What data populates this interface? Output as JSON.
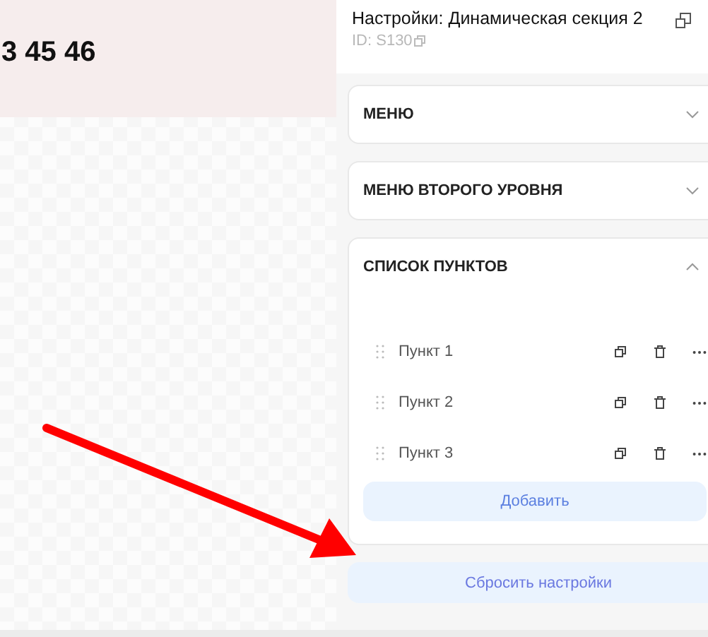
{
  "canvas": {
    "heading": "3 45 46"
  },
  "panel": {
    "title": "Настройки: Динамическая секция 2",
    "id_label": "ID: S130",
    "sections": [
      {
        "title": "МЕНЮ",
        "expanded": false
      },
      {
        "title": "МЕНЮ ВТОРОГО УРОВНЯ",
        "expanded": false
      },
      {
        "title": "СПИСОК ПУНКТОВ",
        "expanded": true,
        "items": [
          {
            "label": "Пункт 1"
          },
          {
            "label": "Пункт 2"
          },
          {
            "label": "Пункт 3"
          }
        ],
        "add_button": "Добавить"
      }
    ],
    "reset_button": "Сбросить настройки"
  }
}
